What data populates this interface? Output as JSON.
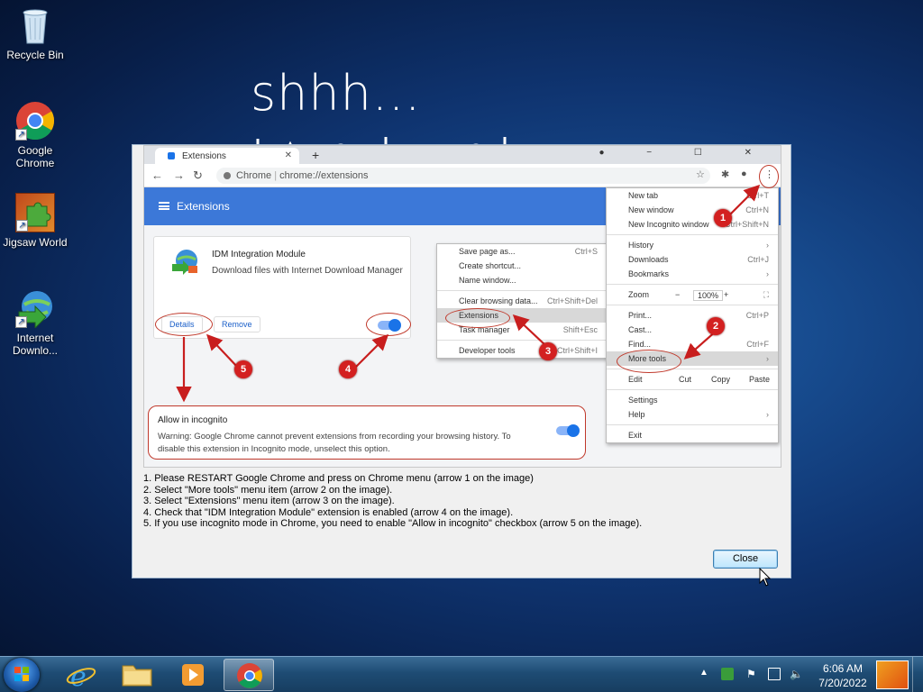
{
  "desktop": {
    "icons": [
      {
        "label": "Recycle Bin"
      },
      {
        "label": "Google Chrome"
      },
      {
        "label": "Jigsaw World"
      },
      {
        "label": "Internet Downlo..."
      }
    ],
    "overlay_text": "shhh..."
  },
  "dialog": {
    "screenshot": {
      "tab_title": "Extensions",
      "url_site": "Chrome",
      "url_path": "chrome://extensions",
      "header_title": "Extensions",
      "extension_name": "IDM Integration Module",
      "extension_desc": "Download files with Internet Download Manager",
      "details_btn": "Details",
      "remove_btn": "Remove",
      "incognito_title": "Allow in incognito",
      "incognito_warning": "Warning: Google Chrome cannot prevent extensions from recording your browsing history. To disable this extension in Incognito mode, unselect this option.",
      "more_tools_menu": [
        {
          "label": "Save page as...",
          "shortcut": "Ctrl+S"
        },
        {
          "label": "Create shortcut...",
          "shortcut": ""
        },
        {
          "label": "Name window...",
          "shortcut": ""
        },
        {
          "label": "Clear browsing data...",
          "shortcut": "Ctrl+Shift+Del"
        },
        {
          "label": "Extensions",
          "shortcut": ""
        },
        {
          "label": "Task manager",
          "shortcut": "Shift+Esc"
        },
        {
          "label": "Developer tools",
          "shortcut": "Ctrl+Shift+I"
        }
      ],
      "chrome_menu": [
        {
          "label": "New tab",
          "shortcut": "Ctrl+T"
        },
        {
          "label": "New window",
          "shortcut": "Ctrl+N"
        },
        {
          "label": "New Incognito window",
          "shortcut": "Ctrl+Shift+N"
        },
        {
          "label": "History",
          "shortcut": ""
        },
        {
          "label": "Downloads",
          "shortcut": "Ctrl+J"
        },
        {
          "label": "Bookmarks",
          "shortcut": ""
        },
        {
          "label": "Zoom",
          "shortcut": ""
        },
        {
          "label": "Print...",
          "shortcut": "Ctrl+P"
        },
        {
          "label": "Cast...",
          "shortcut": ""
        },
        {
          "label": "Find...",
          "shortcut": "Ctrl+F"
        },
        {
          "label": "More tools",
          "shortcut": ""
        },
        {
          "label": "Edit",
          "shortcut": ""
        },
        {
          "label": "Settings",
          "shortcut": ""
        },
        {
          "label": "Help",
          "shortcut": ""
        },
        {
          "label": "Exit",
          "shortcut": ""
        }
      ],
      "zoom": {
        "minus": "−",
        "value": "100%",
        "plus": "+"
      },
      "edit_row": {
        "cut": "Cut",
        "copy": "Copy",
        "paste": "Paste"
      },
      "badges": [
        "1",
        "2",
        "3",
        "4",
        "5"
      ]
    },
    "instructions": [
      "1. Please RESTART Google Chrome and press on Chrome menu (arrow 1 on the image)",
      "2. Select \"More tools\" menu item (arrow 2 on the image).",
      "3. Select \"Extensions\" menu item (arrow 3 on the image).",
      "4. Check that \"IDM Integration Module\" extension is enabled (arrow 4 on the image).",
      "5. If you use incognito mode in Chrome, you need to enable \"Allow in incognito\" checkbox (arrow 5 on the image)."
    ],
    "close_button": "Close"
  },
  "taskbar": {
    "clock_time": "6:06 AM",
    "clock_date": "7/20/2022",
    "show_hidden": "▲"
  }
}
